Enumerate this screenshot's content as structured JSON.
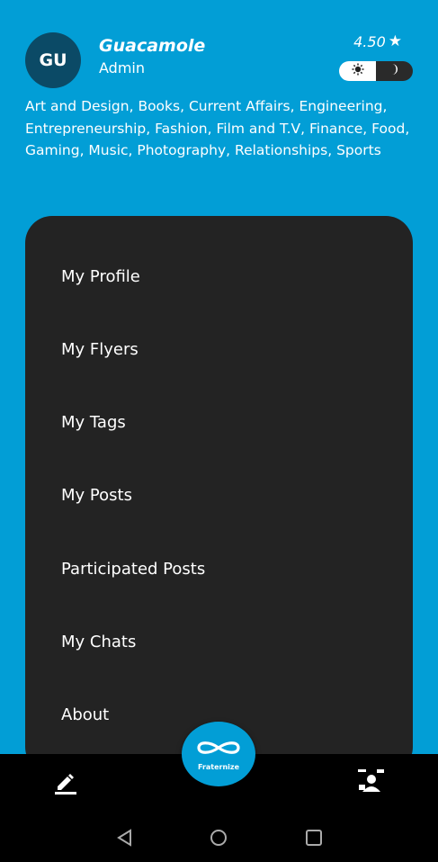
{
  "user": {
    "initials": "GU",
    "name": "Guacamole",
    "role": "Admin",
    "rating": "4.50"
  },
  "theme_toggle": {
    "light_icon": "sun-icon",
    "dark_icon": "moon-icon",
    "selected": "light"
  },
  "interests": "Art and Design, Books, Current Affairs, Engineering, Entrepreneurship, Fashion, Film and T.V, Finance, Food, Gaming, Music, Photography, Relationships, Sports",
  "menu": {
    "items": [
      {
        "label": "My Profile"
      },
      {
        "label": "My Flyers"
      },
      {
        "label": "My Tags"
      },
      {
        "label": "My Posts"
      },
      {
        "label": "Participated Posts"
      },
      {
        "label": "My Chats"
      },
      {
        "label": "About"
      }
    ]
  },
  "bottom_bar": {
    "fab_label": "Fraternize",
    "left_icon": "edit-icon",
    "right_icon": "profile-icon"
  },
  "colors": {
    "brand": "#029ed6",
    "panel": "#232323",
    "avatar": "#0b4a66"
  }
}
